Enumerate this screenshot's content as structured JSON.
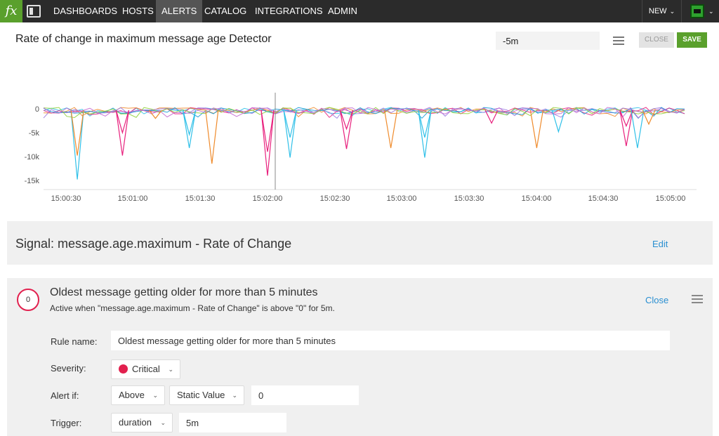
{
  "nav": {
    "logo": "fx",
    "items": [
      {
        "label": "DASHBOARDS",
        "active": false
      },
      {
        "label": "HOSTS",
        "active": false
      },
      {
        "label": "ALERTS",
        "active": true
      },
      {
        "label": "CATALOG",
        "active": false
      },
      {
        "label": "INTEGRATIONS",
        "active": false
      },
      {
        "label": "ADMIN",
        "active": false
      }
    ],
    "new_label": "NEW",
    "chevron": "⌄"
  },
  "header": {
    "title": "Rate of change in maximum message age Detector",
    "time_range": "-5m",
    "close_label": "CLOSE",
    "save_label": "SAVE"
  },
  "chart_data": {
    "type": "line",
    "y_ticks": [
      "0",
      "-5k",
      "-10k",
      "-15k"
    ],
    "x_ticks": [
      "15:00:30",
      "15:01:00",
      "15:01:30",
      "15:02:00",
      "15:02:30",
      "15:03:00",
      "15:03:30",
      "15:04:00",
      "15:04:30",
      "15:05:00"
    ],
    "ylim": [
      -16000,
      1500
    ],
    "series_colors": [
      "#2fc0e8",
      "#e8207d",
      "#ef8b2c",
      "#9b7be0",
      "#1a9bd6",
      "#8ed03a",
      "#c46ad0"
    ],
    "spikes": [
      {
        "t": 15.0097,
        "v": -14800,
        "color": "#2fc0e8"
      },
      {
        "t": 15.0097,
        "v": -9800,
        "color": "#ef8b2c"
      },
      {
        "t": 15.0153,
        "v": -9800,
        "color": "#e8207d"
      },
      {
        "t": 15.0153,
        "v": -5000,
        "color": "#e8207d"
      },
      {
        "t": 15.0194,
        "v": -2000,
        "color": "#ef8b2c"
      },
      {
        "t": 15.0236,
        "v": -8200,
        "color": "#2fc0e8"
      },
      {
        "t": 15.0236,
        "v": -5400,
        "color": "#2fc0e8"
      },
      {
        "t": 15.0264,
        "v": -11500,
        "color": "#ef8b2c"
      },
      {
        "t": 15.0333,
        "v": -14000,
        "color": "#e8207d"
      },
      {
        "t": 15.0333,
        "v": -9000,
        "color": "#e8207d"
      },
      {
        "t": 15.0361,
        "v": -10200,
        "color": "#2fc0e8"
      },
      {
        "t": 15.0361,
        "v": -6000,
        "color": "#2fc0e8"
      },
      {
        "t": 15.0431,
        "v": -8400,
        "color": "#e8207d"
      },
      {
        "t": 15.0431,
        "v": -4200,
        "color": "#e8207d"
      },
      {
        "t": 15.0486,
        "v": -8200,
        "color": "#ef8b2c"
      },
      {
        "t": 15.0528,
        "v": -10200,
        "color": "#2fc0e8"
      },
      {
        "t": 15.0528,
        "v": -6000,
        "color": "#2fc0e8"
      },
      {
        "t": 15.0611,
        "v": -3000,
        "color": "#e8207d"
      },
      {
        "t": 15.0667,
        "v": -8200,
        "color": "#ef8b2c"
      },
      {
        "t": 15.0694,
        "v": -4800,
        "color": "#2fc0e8"
      },
      {
        "t": 15.0778,
        "v": -7800,
        "color": "#e8207d"
      },
      {
        "t": 15.0778,
        "v": -3600,
        "color": "#e8207d"
      },
      {
        "t": 15.0792,
        "v": -8200,
        "color": "#2fc0e8"
      },
      {
        "t": 15.0806,
        "v": -3200,
        "color": "#ef8b2c"
      }
    ]
  },
  "signal": {
    "title": "Signal: message.age.maximum - Rate of Change",
    "edit_label": "Edit"
  },
  "rule": {
    "badge": "0",
    "title": "Oldest message getting older for more than 5 minutes",
    "description": "Active when \"message.age.maximum - Rate of Change\" is above \"0\" for 5m.",
    "close_label": "Close",
    "fields": {
      "rule_name_label": "Rule name:",
      "rule_name_value": "Oldest message getting older for more than 5 minutes",
      "severity_label": "Severity:",
      "severity_value": "Critical",
      "severity_color": "#e2204e",
      "alert_if_label": "Alert if:",
      "alert_if_value": "Above",
      "alert_type_value": "Static Value",
      "threshold_value": "0",
      "trigger_label": "Trigger:",
      "trigger_value": "duration",
      "duration_value": "5m"
    }
  },
  "icons": {
    "panel_toggle": "panel-toggle-icon",
    "menu": "hamburger-menu-icon",
    "chevron": "chevron-down-icon"
  },
  "colors": {
    "brand_green": "#5aa02c",
    "link_blue": "#2a8fd1",
    "critical_red": "#e2204e",
    "nav_bg": "#2b2b2b"
  }
}
